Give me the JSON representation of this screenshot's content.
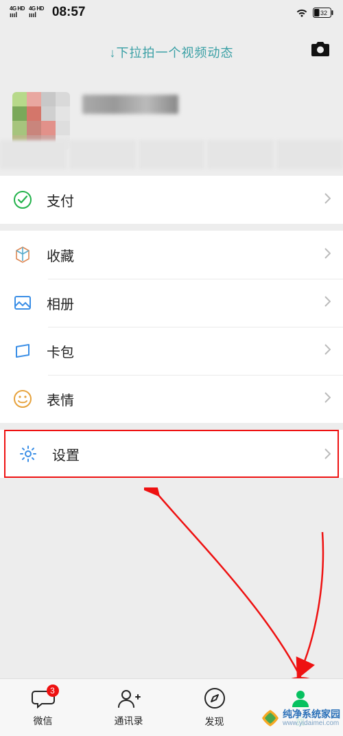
{
  "status": {
    "signal1": "4G HD",
    "signal2": "4G HD",
    "time": "08:57",
    "battery_pct": "32"
  },
  "top": {
    "hint": "↓下拉拍一个视频动态"
  },
  "menu": {
    "pay": "支付",
    "fav": "收藏",
    "album": "相册",
    "cards": "卡包",
    "stickers": "表情",
    "settings": "设置"
  },
  "tabs": {
    "chats": "微信",
    "contacts": "通讯录",
    "discover": "发现",
    "me": "我",
    "badge": "3"
  },
  "watermark": {
    "name": "纯净系统家园",
    "url": "www.yidaimei.com"
  }
}
